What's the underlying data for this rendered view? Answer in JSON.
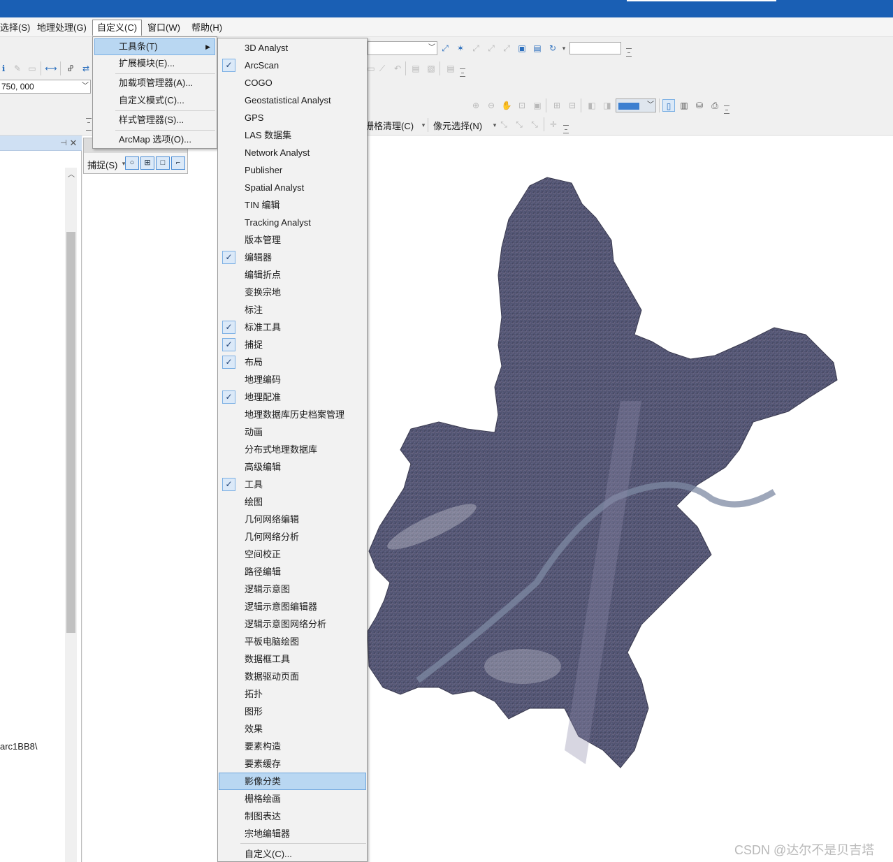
{
  "menubar": {
    "items": [
      {
        "label": "选择(S)"
      },
      {
        "label": "地理处理(G)"
      },
      {
        "label": "自定义(C)"
      },
      {
        "label": "窗口(W)"
      },
      {
        "label": "帮助(H)"
      }
    ]
  },
  "toolbar": {
    "scale_value": "750, 000",
    "raster_cleanup_label": "栅格清理(C)",
    "pixel_select_label": "像元选择(N)",
    "snapping_label": "捕捉(S)",
    "left_pane_path_fragment": "arc1BB8\\"
  },
  "customize_menu": {
    "items": [
      {
        "label": "工具条(T)"
      },
      {
        "label": "扩展模块(E)..."
      },
      {
        "label": "加载项管理器(A)..."
      },
      {
        "label": "自定义模式(C)..."
      },
      {
        "label": "样式管理器(S)..."
      },
      {
        "label": "ArcMap 选项(O)..."
      }
    ]
  },
  "toolbars_submenu": {
    "items": [
      {
        "label": "3D Analyst",
        "checked": false
      },
      {
        "label": "ArcScan",
        "checked": true
      },
      {
        "label": "COGO",
        "checked": false
      },
      {
        "label": "Geostatistical Analyst",
        "checked": false
      },
      {
        "label": "GPS",
        "checked": false
      },
      {
        "label": "LAS 数据集",
        "checked": false
      },
      {
        "label": "Network Analyst",
        "checked": false
      },
      {
        "label": "Publisher",
        "checked": false
      },
      {
        "label": "Spatial Analyst",
        "checked": false
      },
      {
        "label": "TIN 编辑",
        "checked": false
      },
      {
        "label": "Tracking Analyst",
        "checked": false
      },
      {
        "label": "版本管理",
        "checked": false
      },
      {
        "label": "编辑器",
        "checked": true
      },
      {
        "label": "编辑折点",
        "checked": false
      },
      {
        "label": "变换宗地",
        "checked": false
      },
      {
        "label": "标注",
        "checked": false
      },
      {
        "label": "标准工具",
        "checked": true
      },
      {
        "label": "捕捉",
        "checked": true
      },
      {
        "label": "布局",
        "checked": true
      },
      {
        "label": "地理编码",
        "checked": false
      },
      {
        "label": "地理配准",
        "checked": true
      },
      {
        "label": "地理数据库历史档案管理",
        "checked": false
      },
      {
        "label": "动画",
        "checked": false
      },
      {
        "label": "分布式地理数据库",
        "checked": false
      },
      {
        "label": "高级编辑",
        "checked": false
      },
      {
        "label": "工具",
        "checked": true
      },
      {
        "label": "绘图",
        "checked": false
      },
      {
        "label": "几何网络编辑",
        "checked": false
      },
      {
        "label": "几何网络分析",
        "checked": false
      },
      {
        "label": "空间校正",
        "checked": false
      },
      {
        "label": "路径编辑",
        "checked": false
      },
      {
        "label": "逻辑示意图",
        "checked": false
      },
      {
        "label": "逻辑示意图编辑器",
        "checked": false
      },
      {
        "label": "逻辑示意图网络分析",
        "checked": false
      },
      {
        "label": "平板电脑绘图",
        "checked": false
      },
      {
        "label": "数据框工具",
        "checked": false
      },
      {
        "label": "数据驱动页面",
        "checked": false
      },
      {
        "label": "拓扑",
        "checked": false
      },
      {
        "label": "图形",
        "checked": false
      },
      {
        "label": "效果",
        "checked": false
      },
      {
        "label": "要素构造",
        "checked": false
      },
      {
        "label": "要素缓存",
        "checked": false
      },
      {
        "label": "影像分类",
        "checked": false
      },
      {
        "label": "栅格绘画",
        "checked": false
      },
      {
        "label": "制图表达",
        "checked": false
      },
      {
        "label": "宗地编辑器",
        "checked": false
      }
    ],
    "customize_label": "自定义(C)...",
    "highlighted_label": "影像分类"
  },
  "watermark": "CSDN @达尔不是贝吉塔",
  "colors": {
    "titlebar": "#1a5fb4",
    "highlight": "#b9d7f2",
    "check_box": "#dbe9f8"
  }
}
